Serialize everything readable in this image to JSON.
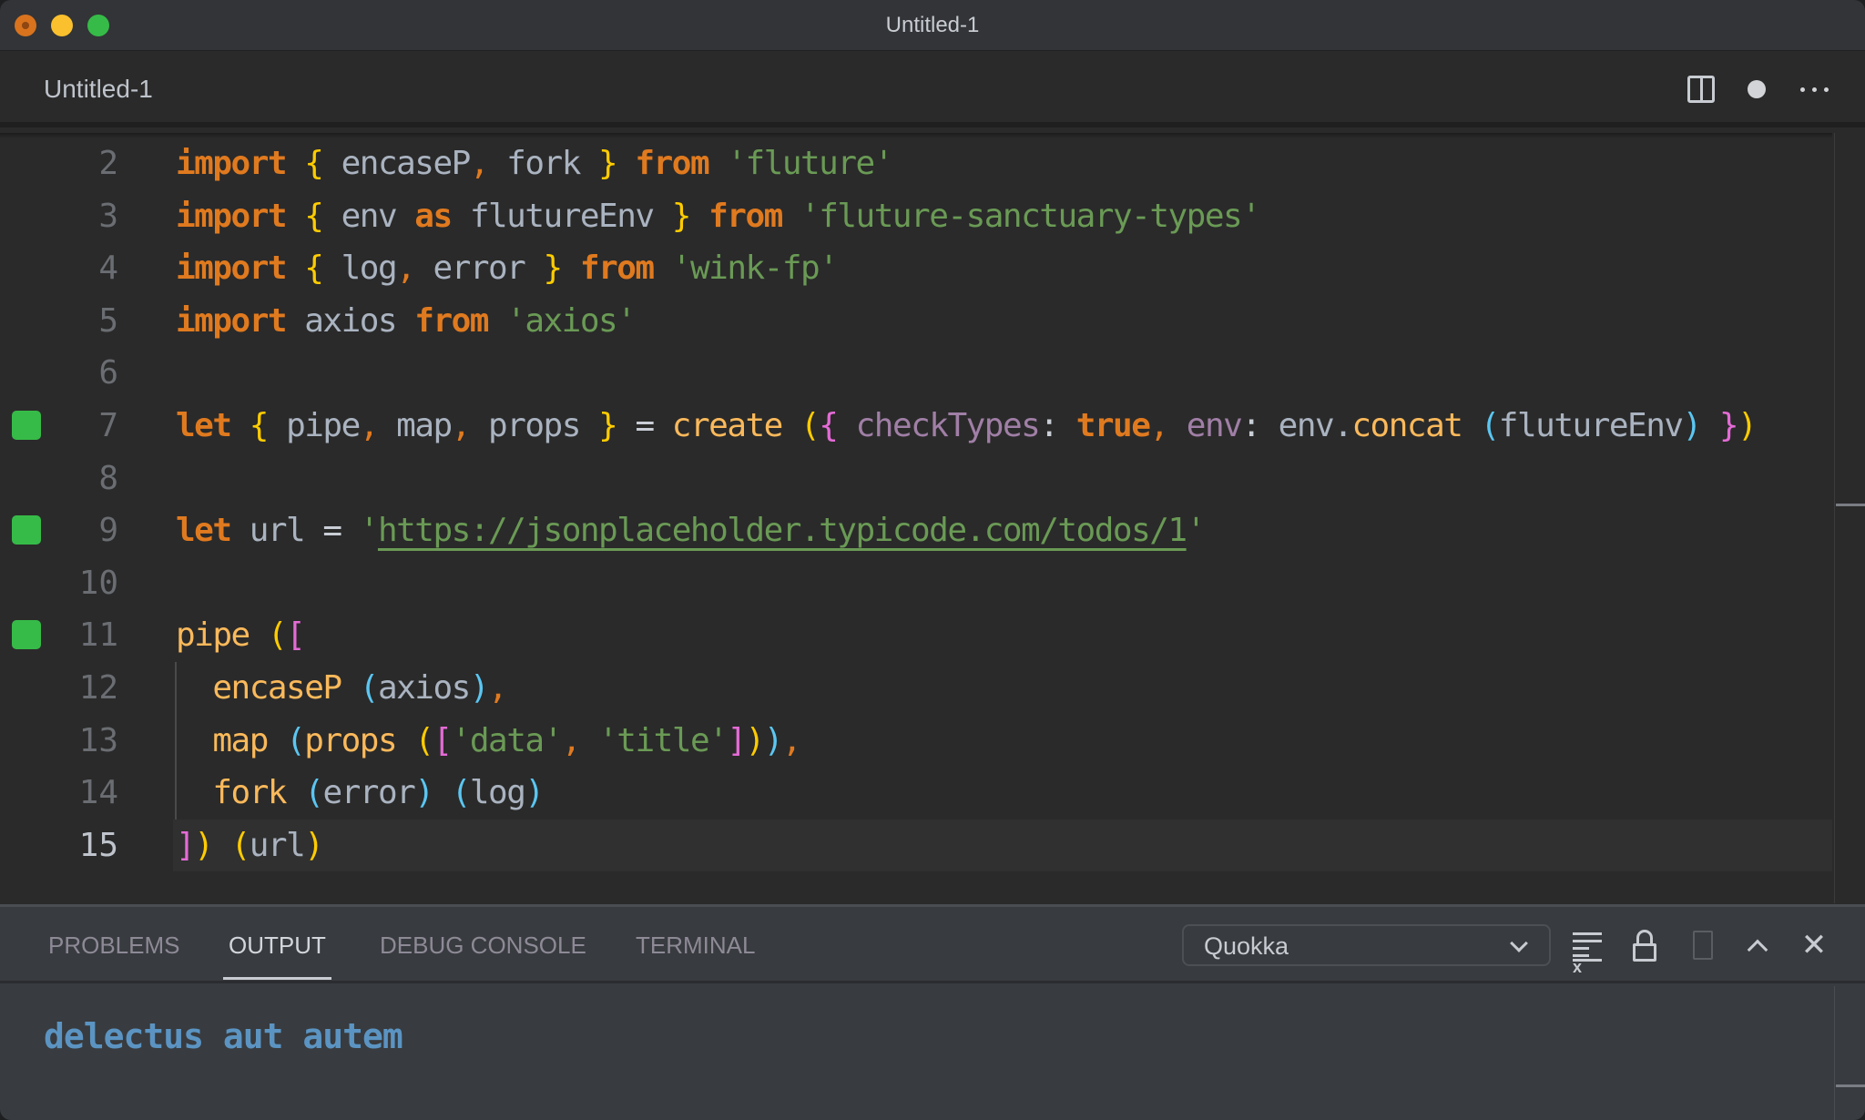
{
  "window": {
    "title": "Untitled-1",
    "traffic_lights": [
      "close",
      "minimize",
      "maximize"
    ]
  },
  "tabbar": {
    "tab_label": "Untitled-1",
    "icons": {
      "split": "split-editor-icon",
      "dirty": "unsaved-dot-icon",
      "more": "more-actions-icon"
    }
  },
  "editor": {
    "language": "javascript",
    "current_line": 15,
    "quokka_markers_on_lines": [
      7,
      9,
      11
    ],
    "lines": [
      {
        "n": "2",
        "tokens": [
          [
            "kw",
            "import"
          ],
          [
            "var",
            " "
          ],
          [
            "b1",
            "{"
          ],
          [
            "var",
            " encaseP"
          ],
          [
            "punc",
            ","
          ],
          [
            "var",
            " fork "
          ],
          [
            "b1",
            "}"
          ],
          [
            "var",
            " "
          ],
          [
            "kw",
            "from"
          ],
          [
            "var",
            " "
          ],
          [
            "str",
            "'fluture'"
          ]
        ]
      },
      {
        "n": "3",
        "tokens": [
          [
            "kw",
            "import"
          ],
          [
            "var",
            " "
          ],
          [
            "b1",
            "{"
          ],
          [
            "var",
            " env "
          ],
          [
            "kw",
            "as"
          ],
          [
            "var",
            " flutureEnv "
          ],
          [
            "b1",
            "}"
          ],
          [
            "var",
            " "
          ],
          [
            "kw",
            "from"
          ],
          [
            "var",
            " "
          ],
          [
            "str",
            "'fluture-sanctuary-types'"
          ]
        ]
      },
      {
        "n": "4",
        "tokens": [
          [
            "kw",
            "import"
          ],
          [
            "var",
            " "
          ],
          [
            "b1",
            "{"
          ],
          [
            "var",
            " log"
          ],
          [
            "punc",
            ","
          ],
          [
            "var",
            " error "
          ],
          [
            "b1",
            "}"
          ],
          [
            "var",
            " "
          ],
          [
            "kw",
            "from"
          ],
          [
            "var",
            " "
          ],
          [
            "str",
            "'wink-fp'"
          ]
        ]
      },
      {
        "n": "5",
        "tokens": [
          [
            "kw",
            "import"
          ],
          [
            "var",
            " axios "
          ],
          [
            "kw",
            "from"
          ],
          [
            "var",
            " "
          ],
          [
            "str",
            "'axios'"
          ]
        ]
      },
      {
        "n": "6",
        "tokens": []
      },
      {
        "n": "7",
        "tokens": [
          [
            "kw",
            "let"
          ],
          [
            "var",
            " "
          ],
          [
            "b1",
            "{"
          ],
          [
            "var",
            " pipe"
          ],
          [
            "punc",
            ","
          ],
          [
            "var",
            " map"
          ],
          [
            "punc",
            ","
          ],
          [
            "var",
            " props "
          ],
          [
            "b1",
            "}"
          ],
          [
            "op",
            " = "
          ],
          [
            "fn",
            "create"
          ],
          [
            "var",
            " "
          ],
          [
            "b1",
            "("
          ],
          [
            "b2",
            "{"
          ],
          [
            "var",
            " "
          ],
          [
            "prop",
            "checkTypes"
          ],
          [
            "op",
            ": "
          ],
          [
            "kw",
            "true"
          ],
          [
            "punc",
            ","
          ],
          [
            "var",
            " "
          ],
          [
            "prop",
            "env"
          ],
          [
            "op",
            ": "
          ],
          [
            "var",
            "env."
          ],
          [
            "fn",
            "concat"
          ],
          [
            "var",
            " "
          ],
          [
            "b3",
            "("
          ],
          [
            "var",
            "flutureEnv"
          ],
          [
            "b3",
            ")"
          ],
          [
            "var",
            " "
          ],
          [
            "b2",
            "}"
          ],
          [
            "b1",
            ")"
          ]
        ]
      },
      {
        "n": "8",
        "tokens": []
      },
      {
        "n": "9",
        "tokens": [
          [
            "kw",
            "let"
          ],
          [
            "var",
            " url "
          ],
          [
            "op",
            "= "
          ],
          [
            "str",
            "'"
          ],
          [
            "url",
            "https://jsonplaceholder.typicode.com/todos/1"
          ],
          [
            "str",
            "'"
          ]
        ]
      },
      {
        "n": "10",
        "tokens": []
      },
      {
        "n": "11",
        "tokens": [
          [
            "fn",
            "pipe"
          ],
          [
            "var",
            " "
          ],
          [
            "b1",
            "("
          ],
          [
            "b2",
            "["
          ]
        ]
      },
      {
        "n": "12",
        "tokens": [
          [
            "var",
            "  "
          ],
          [
            "fn",
            "encaseP"
          ],
          [
            "var",
            " "
          ],
          [
            "b3",
            "("
          ],
          [
            "var",
            "axios"
          ],
          [
            "b3",
            ")"
          ],
          [
            "punc",
            ","
          ]
        ]
      },
      {
        "n": "13",
        "tokens": [
          [
            "var",
            "  "
          ],
          [
            "fn",
            "map"
          ],
          [
            "var",
            " "
          ],
          [
            "b3",
            "("
          ],
          [
            "fn",
            "props"
          ],
          [
            "var",
            " "
          ],
          [
            "b1",
            "("
          ],
          [
            "b2",
            "["
          ],
          [
            "str",
            "'data'"
          ],
          [
            "punc",
            ","
          ],
          [
            "var",
            " "
          ],
          [
            "str",
            "'title'"
          ],
          [
            "b2",
            "]"
          ],
          [
            "b1",
            ")"
          ],
          [
            "b3",
            ")"
          ],
          [
            "punc",
            ","
          ]
        ]
      },
      {
        "n": "14",
        "tokens": [
          [
            "var",
            "  "
          ],
          [
            "fn",
            "fork"
          ],
          [
            "var",
            " "
          ],
          [
            "b3",
            "("
          ],
          [
            "var",
            "error"
          ],
          [
            "b3",
            ")"
          ],
          [
            "var",
            " "
          ],
          [
            "b3",
            "("
          ],
          [
            "var",
            "log"
          ],
          [
            "b3",
            ")"
          ]
        ]
      },
      {
        "n": "15",
        "tokens": [
          [
            "b2",
            "]"
          ],
          [
            "b1",
            ")"
          ],
          [
            "var",
            " "
          ],
          [
            "b1",
            "("
          ],
          [
            "var",
            "url"
          ],
          [
            "b1",
            ")"
          ]
        ]
      }
    ]
  },
  "panel": {
    "tabs": [
      {
        "label": "PROBLEMS",
        "active": false
      },
      {
        "label": "OUTPUT",
        "active": true
      },
      {
        "label": "DEBUG CONSOLE",
        "active": false
      },
      {
        "label": "TERMINAL",
        "active": false
      }
    ],
    "channel_select": {
      "value": "Quokka"
    },
    "actions": [
      "clear-output-icon",
      "lock-scroll-icon",
      "open-log-file-icon",
      "maximize-panel-icon",
      "close-panel-icon"
    ],
    "output": "delectus aut autem"
  },
  "colors": {
    "keyword": "#e07a1f",
    "function": "#fab95b",
    "string": "#6a9a55",
    "identifier": "#aab3c0",
    "property": "#a07fa6",
    "bracket_1": "#ffcc00",
    "bracket_2": "#e46bd6",
    "bracket_3": "#5bc6f2",
    "quokka_marker": "#36bb48",
    "output_text": "#5b94c2"
  }
}
